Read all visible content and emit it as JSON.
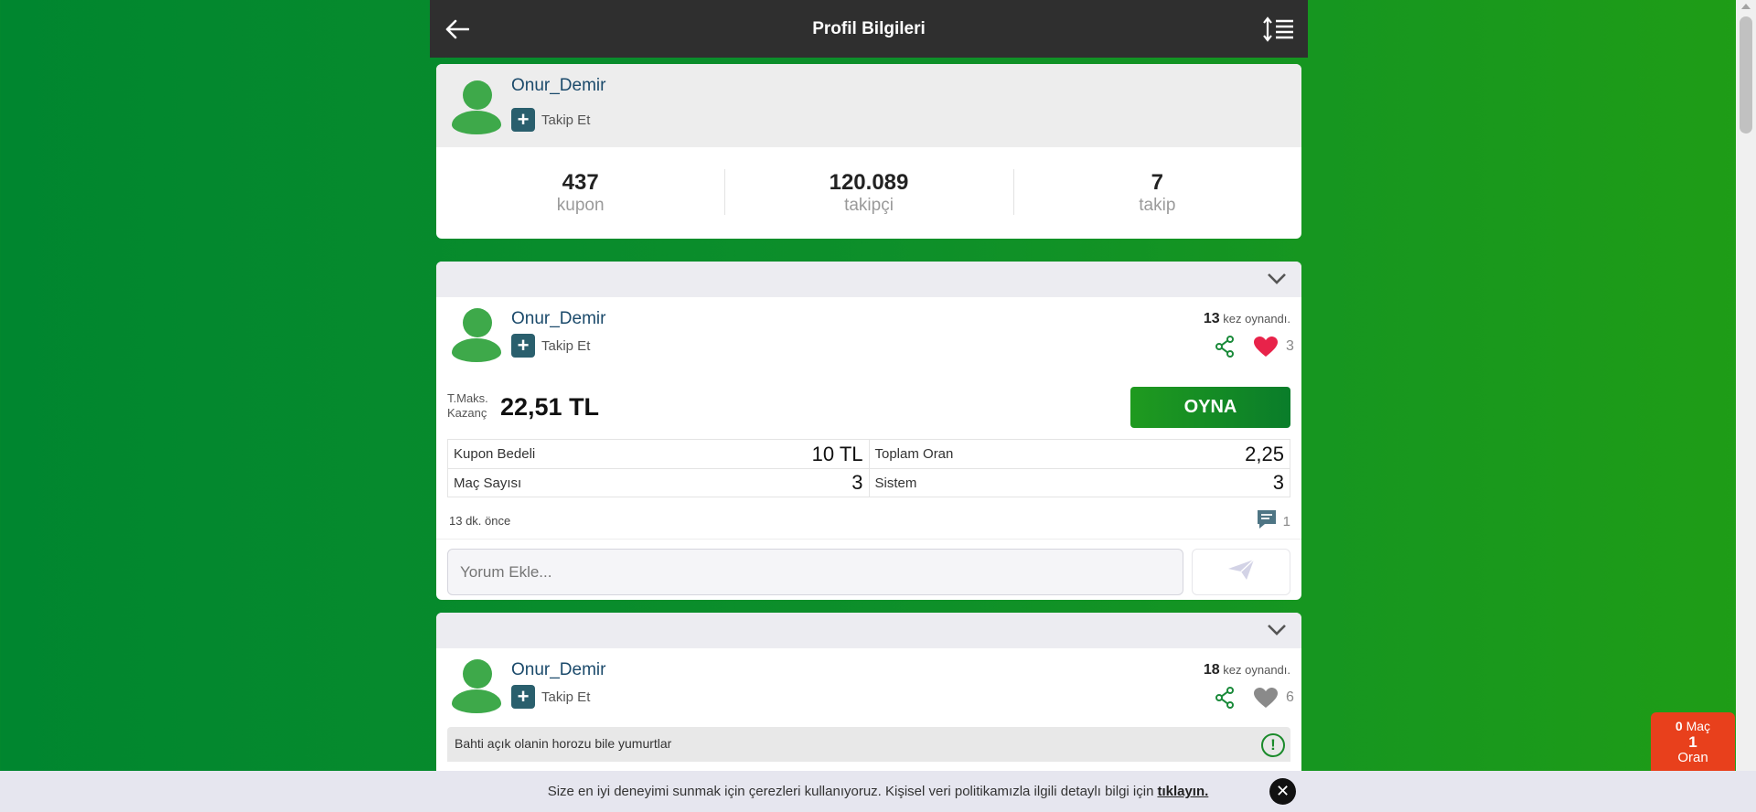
{
  "header": {
    "title": "Profil Bilgileri",
    "back_icon": "arrow-left-icon",
    "sort_icon": "sort-list-icon"
  },
  "profile": {
    "username": "Onur_Demir",
    "follow_label": "Takip Et",
    "stats": [
      {
        "value": "437",
        "label": "kupon"
      },
      {
        "value": "120.089",
        "label": "takipçi"
      },
      {
        "value": "7",
        "label": "takip"
      }
    ]
  },
  "coupons": [
    {
      "username": "Onur_Demir",
      "follow_label": "Takip Et",
      "played_count": "13",
      "played_suffix": "kez oynandı.",
      "likes": "3",
      "liked": true,
      "max_win_label_1": "T.Maks.",
      "max_win_label_2": "Kazanç",
      "max_win_value": "22,51 TL",
      "play_label": "OYNA",
      "details": {
        "coupon_fee_label": "Kupon Bedeli",
        "coupon_fee_value": "10 TL",
        "total_odds_label": "Toplam Oran",
        "total_odds_value": "2,25",
        "match_count_label": "Maç Sayısı",
        "match_count_value": "3",
        "system_label": "Sistem",
        "system_value": "3"
      },
      "time_ago": "13 dk. önce",
      "comment_count": "1",
      "comment_placeholder": "Yorum Ekle..."
    },
    {
      "username": "Onur_Demir",
      "follow_label": "Takip Et",
      "played_count": "18",
      "played_suffix": "kez oynandı.",
      "likes": "6",
      "liked": false,
      "note": "Bahti açık olanin horozu bile yumurtlar"
    }
  ],
  "cookie": {
    "text": "Size en iyi deneyimi sunmak için çerezleri kullanıyoruz. Kişisel veri politikamızla ilgili detaylı bilgi için",
    "link": "tıklayın."
  },
  "betslip": {
    "match_count": "0",
    "match_label": "Maç",
    "odds_value": "1",
    "odds_label": "Oran"
  },
  "colors": {
    "accent_green": "#1f9a1f",
    "header_bg": "#2f2f2f",
    "heart_active": "#e8234a",
    "betslip_bg": "#e8401c"
  }
}
